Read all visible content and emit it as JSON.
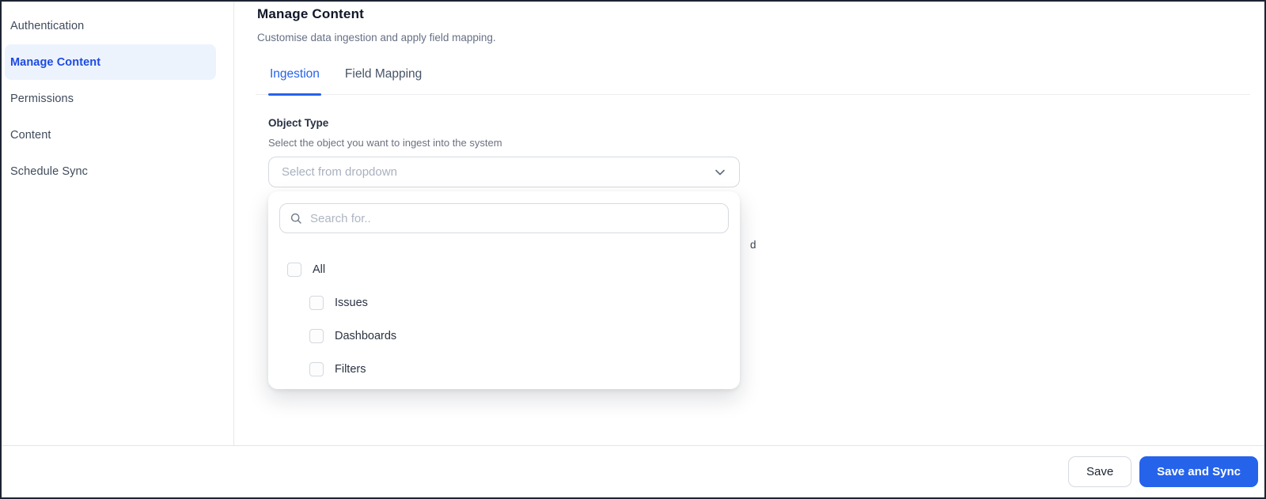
{
  "sidebar": {
    "items": [
      {
        "label": "Authentication",
        "active": false
      },
      {
        "label": "Manage Content",
        "active": true
      },
      {
        "label": "Permissions",
        "active": false
      },
      {
        "label": "Content",
        "active": false
      },
      {
        "label": "Schedule Sync",
        "active": false
      }
    ]
  },
  "header": {
    "title": "Manage Content",
    "subtitle": "Customise data ingestion and apply field mapping."
  },
  "tabs": [
    {
      "label": "Ingestion",
      "active": true
    },
    {
      "label": "Field Mapping",
      "active": false
    }
  ],
  "form": {
    "object_type": {
      "label": "Object Type",
      "help": "Select the object you want to ingest into the system",
      "placeholder": "Select from dropdown"
    },
    "occluded_text_fragment": "d"
  },
  "dropdown": {
    "search_placeholder": "Search for..",
    "options": [
      {
        "label": "All",
        "checked": false,
        "indent": false
      },
      {
        "label": "Issues",
        "checked": false,
        "indent": true
      },
      {
        "label": "Dashboards",
        "checked": false,
        "indent": true
      },
      {
        "label": "Filters",
        "checked": false,
        "indent": true
      }
    ]
  },
  "footer": {
    "save_label": "Save",
    "save_and_sync_label": "Save and Sync"
  },
  "colors": {
    "accent": "#2563eb",
    "sidebar_active_text": "#1b4ae2",
    "sidebar_active_bg": "#edf3fd",
    "window_border": "#1c2432"
  }
}
